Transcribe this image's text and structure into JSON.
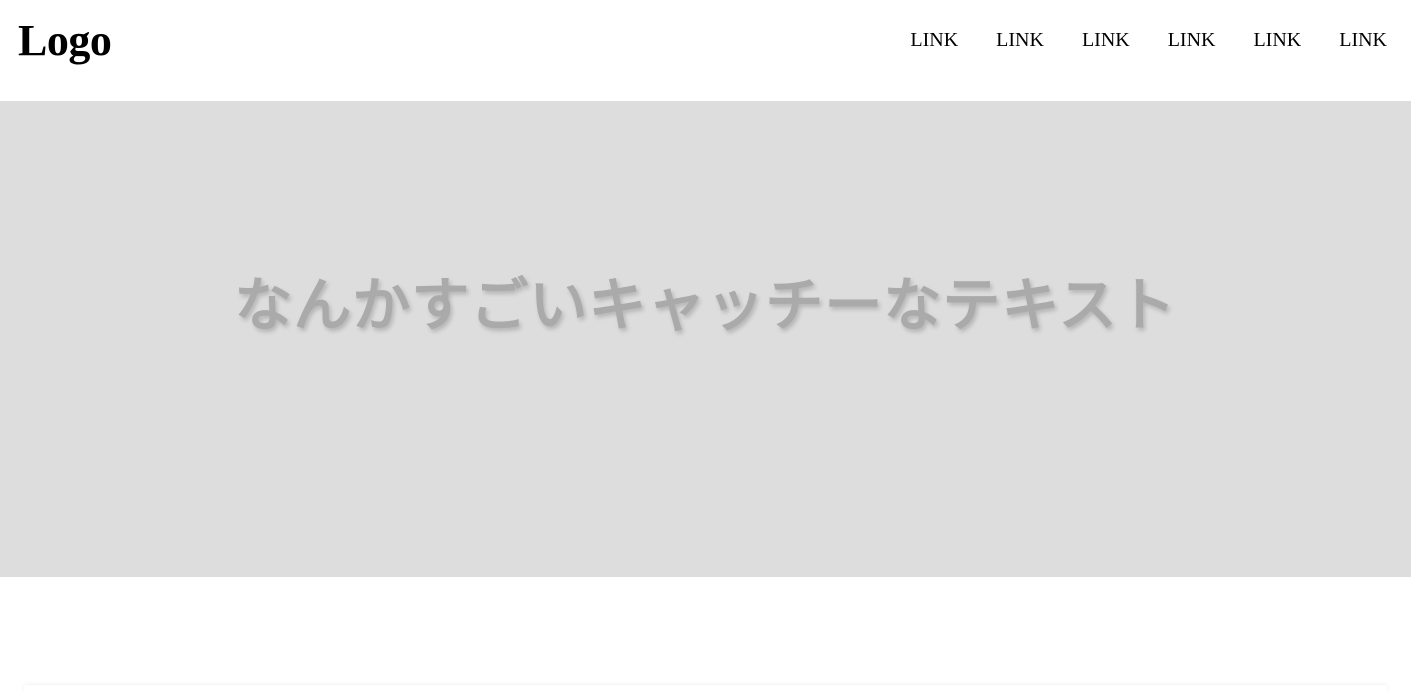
{
  "header": {
    "logo": "Logo",
    "nav": [
      {
        "label": "LINK"
      },
      {
        "label": "LINK"
      },
      {
        "label": "LINK"
      },
      {
        "label": "LINK"
      },
      {
        "label": "LINK"
      },
      {
        "label": "LINK"
      }
    ]
  },
  "hero": {
    "catch_text": "なんかすごいキャッチーなテキスト",
    "background_color": "#dddddd",
    "text_color": "#aaaaaa"
  }
}
